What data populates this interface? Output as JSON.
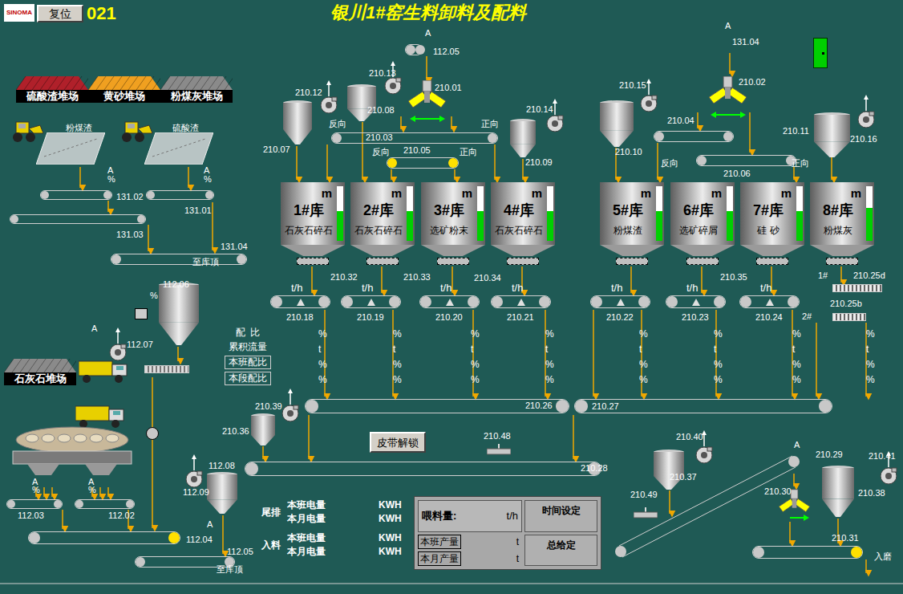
{
  "header": {
    "logo": "SINOMA",
    "reset_button": "复位",
    "screen_number": "021",
    "title": "银川1#窑生料卸料及配料"
  },
  "stockpiles": [
    {
      "label": "硫酸渣堆场",
      "color": "#b0202a"
    },
    {
      "label": "黄砂堆场",
      "color": "#f0a020"
    },
    {
      "label": "粉煤灰堆场",
      "color": "#8a8a8a"
    },
    {
      "label": "石灰石堆场",
      "color": "#8a8a8a"
    }
  ],
  "silos": [
    {
      "name": "1#库",
      "material": "石灰石碎石",
      "unit": "m",
      "level": 0.55
    },
    {
      "name": "2#库",
      "material": "石灰石碎石",
      "unit": "m",
      "level": 0.55
    },
    {
      "name": "3#库",
      "material": "选矿粉末",
      "unit": "m",
      "level": 0.55
    },
    {
      "name": "4#库",
      "material": "石灰石碎石",
      "unit": "m",
      "level": 0.55
    },
    {
      "name": "5#库",
      "material": "粉煤渣",
      "unit": "m",
      "level": 0.55
    },
    {
      "name": "6#库",
      "material": "选矿碎屑",
      "unit": "m",
      "level": 0.55
    },
    {
      "name": "7#库",
      "material": "硅 砂",
      "unit": "m",
      "level": 0.55
    },
    {
      "name": "8#库",
      "material": "粉煤灰",
      "unit": "m",
      "level": 0.6
    }
  ],
  "weigh_feeders": [
    {
      "unit": "t/h",
      "tag": "210.18"
    },
    {
      "unit": "t/h",
      "tag": "210.19"
    },
    {
      "unit": "t/h",
      "tag": "210.20"
    },
    {
      "unit": "t/h",
      "tag": "210.21"
    },
    {
      "unit": "t/h",
      "tag": "210.22"
    },
    {
      "unit": "t/h",
      "tag": "210.23"
    },
    {
      "unit": "t/h",
      "tag": "210.24"
    }
  ],
  "ratio_table": {
    "row_labels": [
      "配  比",
      "累积流量",
      "本班配比",
      "本段配比"
    ],
    "columns": [
      [
        "%",
        "t",
        "%",
        "%"
      ],
      [
        "%",
        "t",
        "%",
        "%"
      ],
      [
        "%",
        "t",
        "%",
        "%"
      ],
      [
        "%",
        "t",
        "%",
        "%"
      ],
      [
        "%",
        "t",
        "%",
        "%"
      ],
      [
        "%",
        "t",
        "%",
        "%"
      ],
      [
        "%",
        "t",
        "%",
        "%"
      ],
      [
        "%",
        "t",
        "%",
        "%"
      ]
    ]
  },
  "tags": [
    "A",
    "112.05",
    "210.12",
    "210.13",
    "210.08",
    "210.01",
    "210.14",
    "210.07",
    "反向",
    "210.03",
    "正向",
    "反向",
    "210.05",
    "正向",
    "210.09",
    "A",
    "131.04",
    "210.15",
    "210.02",
    "210.04",
    "210.11",
    "210.16",
    "210.10",
    "反向",
    "210.06",
    "正向",
    "210.32",
    "210.33",
    "210.34",
    "210.35",
    "1#",
    "210.25d",
    "210.25b",
    "2#",
    "210.26",
    "210.27",
    "210.28",
    "210.36",
    "210.39",
    "210.48",
    "210.40",
    "210.37",
    "210.49",
    "A",
    "210.29",
    "210.30",
    "210.41",
    "210.38",
    "210.31",
    "入磨",
    "112.06",
    "%",
    "A",
    "112.07",
    "112.08",
    "112.09",
    "A",
    "112.04",
    "112.05",
    "至库顶",
    "112.03",
    "112.02",
    "A",
    "%",
    "A",
    "%",
    "粉煤渣",
    "硫酸渣",
    "A",
    "%",
    "A",
    "%",
    "131.02",
    "131.01",
    "131.03",
    "131.04",
    "至库顶"
  ],
  "belt_unlock_button": "皮带解锁",
  "energy": [
    {
      "group": "尾排",
      "rows": [
        {
          "label": "本班电量",
          "unit": "KWH"
        },
        {
          "label": "本月电量",
          "unit": "KWH"
        }
      ]
    },
    {
      "group": "入料",
      "rows": [
        {
          "label": "本班电量",
          "unit": "KWH"
        },
        {
          "label": "本月电量",
          "unit": "KWH"
        }
      ]
    }
  ],
  "feed_panel": {
    "feed_label": "喂料量:",
    "feed_unit": "t/h",
    "time_button": "时间设定",
    "shift_output": "本班产量",
    "shift_unit": "t",
    "month_output": "本月产量",
    "month_unit": "t",
    "total_button": "总给定"
  }
}
